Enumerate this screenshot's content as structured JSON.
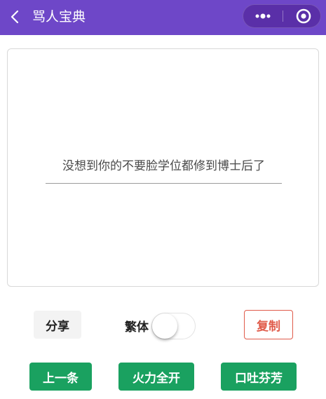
{
  "header": {
    "title": "骂人宝典",
    "back_icon": "chevron-left-icon",
    "more_icon": "more-dots-icon",
    "close_icon": "target-close-icon",
    "background": "#6e47c8"
  },
  "card": {
    "quote": "没想到你的不要脸学位都修到博士后了"
  },
  "actions": {
    "share_label": "分享",
    "traditional_label": "繁体",
    "traditional_enabled": false,
    "copy_label": "复制",
    "copy_color": "#e05b4a"
  },
  "bottom_buttons": {
    "prev_label": "上一条",
    "fire_label": "火力全开",
    "fragrant_label": "口吐芬芳",
    "color": "#1aa160"
  }
}
